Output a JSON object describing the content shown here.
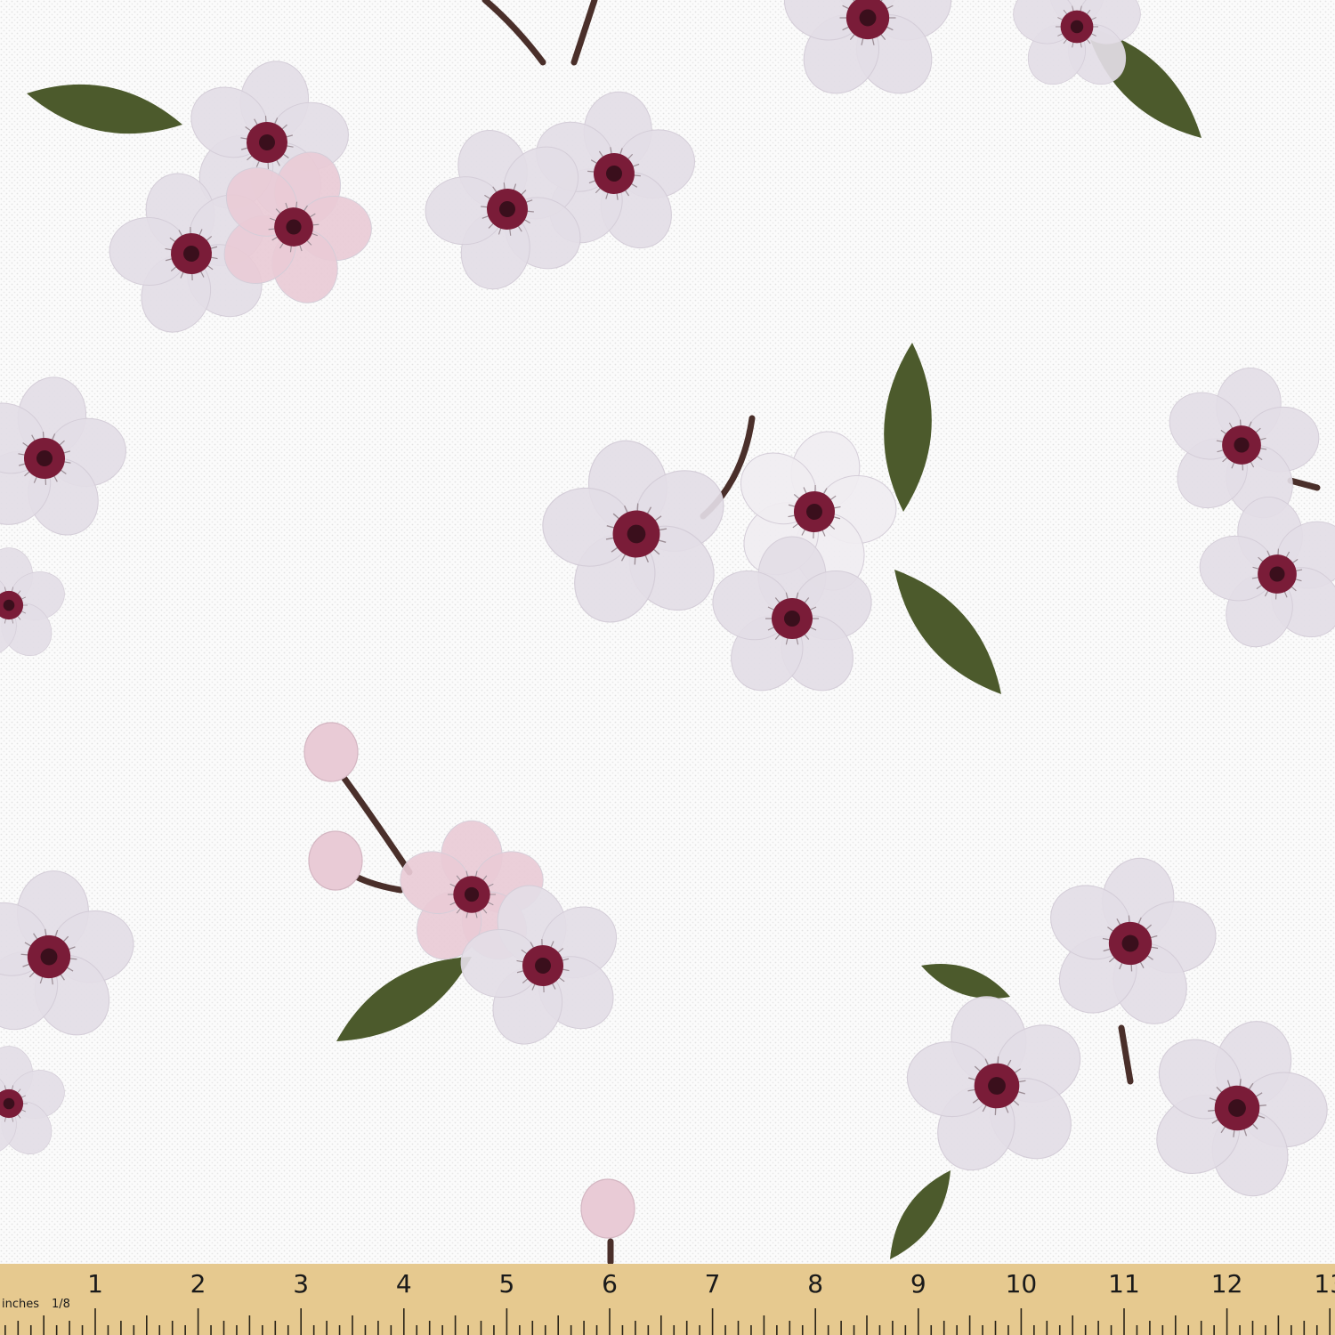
{
  "ruler": {
    "unit_label": "inches",
    "fraction_label": "1/8",
    "numbers": [
      "1",
      "2",
      "3",
      "4",
      "5",
      "6",
      "7",
      "8",
      "9",
      "10",
      "11",
      "12",
      "13"
    ],
    "color": "#e6c98f"
  },
  "palette": {
    "background": "#fbfbfb",
    "petal": "#e3dde6",
    "petal_light": "#f0edf1",
    "petal_pink": "#e9cbd6",
    "center": "#7a1c38",
    "leaf": "#4c5a2c",
    "stem": "#4a2f2a"
  }
}
